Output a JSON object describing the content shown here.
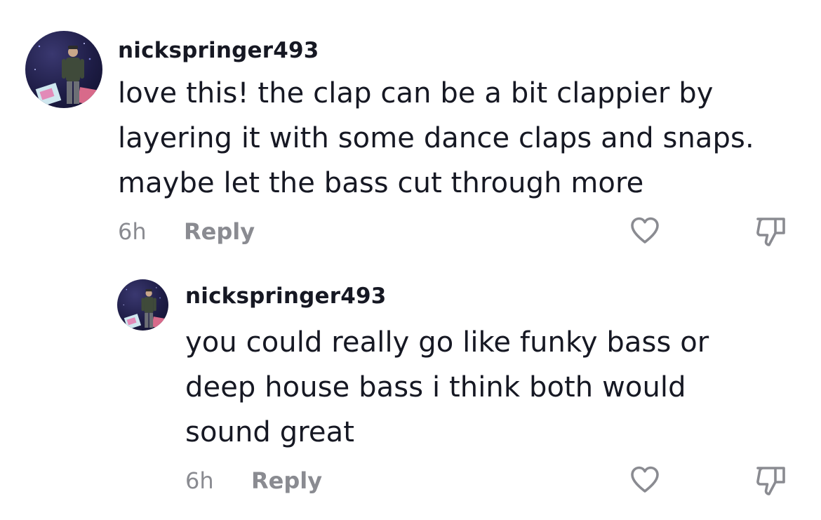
{
  "comments": [
    {
      "username": "nickspringer493",
      "text": "love this! the clap can be a bit clappier by\nlayering it with some dance claps and snaps.\nmaybe let the bass cut through more",
      "time": "6h",
      "reply_label": "Reply",
      "like_icon": "heart-icon",
      "dislike_icon": "thumbs-down-icon"
    },
    {
      "username": "nickspringer493",
      "text": "you could really go like funky bass or\ndeep house bass i think both would\nsound great",
      "time": "6h",
      "reply_label": "Reply",
      "like_icon": "heart-icon",
      "dislike_icon": "thumbs-down-icon"
    }
  ],
  "colors": {
    "text_primary": "#161823",
    "text_secondary": "#8a8b91",
    "icon_stroke": "#8a8b91",
    "background": "#ffffff"
  }
}
